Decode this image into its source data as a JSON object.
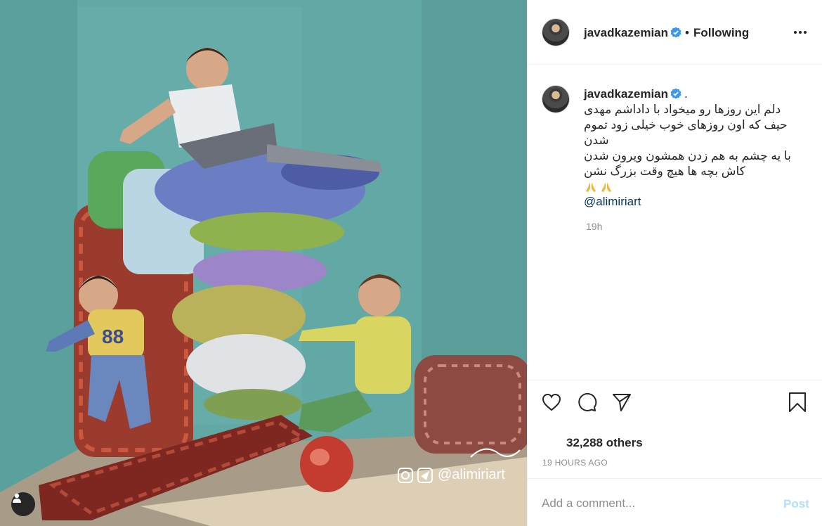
{
  "post": {
    "username": "javadkazemian",
    "follow_status": "Following",
    "separator": "•",
    "caption_dot": ".",
    "caption_lines": [
      "دلم این روزها رو میخواد با داداشم مهدی",
      "حیف که اون روزهای خوب خیلی زود تموم",
      "شدن",
      "با یه چشم به هم زدن همشون ویرون شدن",
      "کاش بچه ها هیچ وقت بزرگ نشن"
    ],
    "mention": "@alimiriart",
    "caption_time": "19h",
    "likes_text": "32,288 others",
    "posted_time": "19 HOURS AGO",
    "comment_placeholder": "Add a comment...",
    "post_label": "Post",
    "image_watermark": "@alimiriart"
  },
  "colors": {
    "verified": "#3897f0",
    "link": "#00376b",
    "post_disabled": "#b2dffc",
    "muted": "#8e8e8e"
  },
  "icons": [
    "more-options-icon",
    "verified-badge-icon",
    "heart-icon",
    "comment-icon",
    "share-icon",
    "bookmark-icon",
    "user-tag-icon",
    "pray-emoji-icon"
  ]
}
